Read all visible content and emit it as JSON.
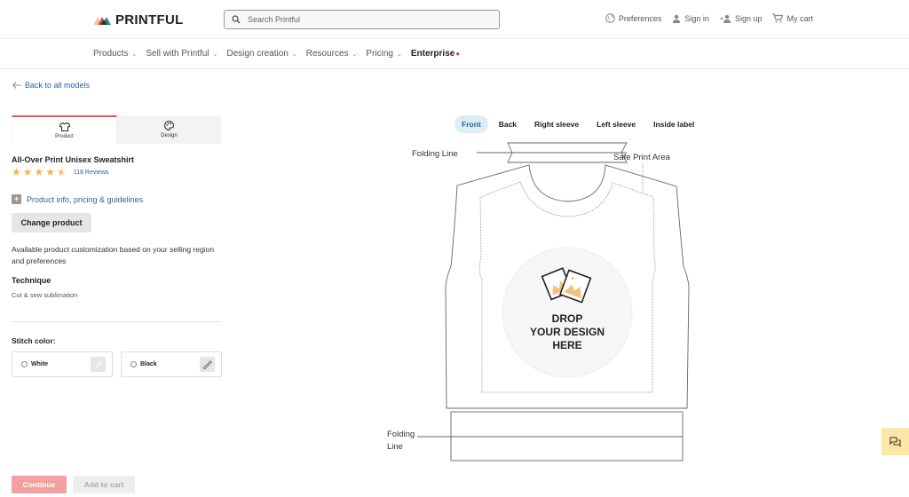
{
  "header": {
    "logo_text": "PRINTFUL",
    "search_placeholder": "Search Printful",
    "links": {
      "preferences": "Preferences",
      "sign_in": "Sign in",
      "sign_up": "Sign up",
      "cart": "My cart"
    }
  },
  "nav": {
    "items": [
      {
        "label": "Products"
      },
      {
        "label": "Sell with Printful"
      },
      {
        "label": "Design creation"
      },
      {
        "label": "Resources"
      },
      {
        "label": "Pricing"
      },
      {
        "label": "Enterprise"
      }
    ]
  },
  "sidebar": {
    "back_label": "Back to all models",
    "tabs": [
      {
        "label": "Product",
        "icon": "tshirt-icon",
        "active": true
      },
      {
        "label": "Design",
        "icon": "palette-icon",
        "active": false
      }
    ],
    "product_title": "All-Over Print Unisex Sweatshirt",
    "rating": 4.5,
    "reviews_label": "118 Reviews",
    "info_link": "Product info, pricing & guidelines",
    "change_product": "Change product",
    "availability_text": "Available product customization based on your selling region and preferences",
    "technique_label": "Technique",
    "technique_value": "Cut & sew sublimation",
    "stitch_label": "Stitch color:",
    "stitch_options": [
      {
        "label": "White",
        "selected": false
      },
      {
        "label": "Black",
        "selected": false
      }
    ],
    "continue_label": "Continue",
    "add_to_cart_label": "Add to cart"
  },
  "editor": {
    "views": [
      {
        "label": "Front",
        "active": true
      },
      {
        "label": "Back",
        "active": false
      },
      {
        "label": "Right sleeve",
        "active": false
      },
      {
        "label": "Left sleeve",
        "active": false
      },
      {
        "label": "Inside label",
        "active": false
      }
    ],
    "folding_line_top": "Folding Line",
    "safe_print_area": "Safe Print Area",
    "folding_line_bottom_1": "Folding",
    "folding_line_bottom_2": "Line",
    "drop_text_1": "DROP",
    "drop_text_2": "YOUR DESIGN",
    "drop_text_3": "HERE"
  },
  "colors": {
    "accent_red": "#e55555",
    "link_blue": "#2a6496",
    "star": "#f0b552",
    "chat_bg": "#fde7a7"
  }
}
